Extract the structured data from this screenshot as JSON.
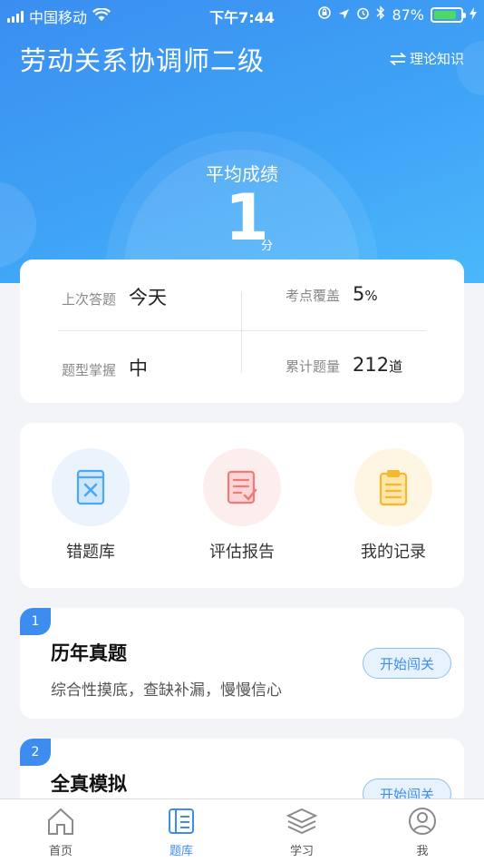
{
  "status_bar": {
    "carrier": "中国移动",
    "time": "下午7:44",
    "battery_percent": "87%",
    "battery_level": 0.87
  },
  "header": {
    "title": "劳动关系协调师二级",
    "switch_label": "理论知识",
    "avg_label": "平均成绩",
    "avg_score": "1",
    "avg_unit": "分"
  },
  "stats": {
    "last_answer": {
      "label": "上次答题",
      "value": "今天"
    },
    "coverage": {
      "label": "考点覆盖",
      "value": "5",
      "unit": "%"
    },
    "mastery": {
      "label": "题型掌握",
      "value": "中"
    },
    "total": {
      "label": "累计题量",
      "value": "212",
      "unit": "道"
    }
  },
  "tools": [
    {
      "label": "错题库",
      "icon": "wrong-book-icon",
      "color": "#4aa8f5"
    },
    {
      "label": "评估报告",
      "icon": "report-icon",
      "color": "#f07a7a"
    },
    {
      "label": "我的记录",
      "icon": "clipboard-icon",
      "color": "#f5b82e"
    }
  ],
  "sections": [
    {
      "index": "1",
      "title": "历年真题",
      "desc": "综合性摸底，查缺补漏，慢慢信心",
      "button": "开始闯关"
    },
    {
      "index": "2",
      "title": "全真模拟",
      "desc": "",
      "button": "开始闯关"
    }
  ],
  "tabbar": {
    "items": [
      {
        "label": "首页",
        "icon": "home-icon"
      },
      {
        "label": "题库",
        "icon": "question-bank-icon"
      },
      {
        "label": "学习",
        "icon": "layers-icon"
      },
      {
        "label": "我",
        "icon": "profile-icon"
      }
    ],
    "active_index": 1,
    "active_color": "#3d8df0"
  }
}
